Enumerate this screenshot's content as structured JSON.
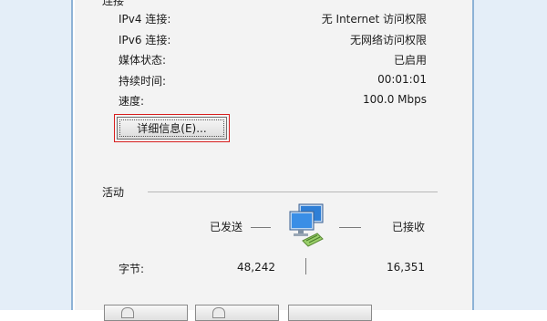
{
  "connection": {
    "title": "连接",
    "rows": [
      {
        "label": "IPv4 连接:",
        "value": "无 Internet 访问权限"
      },
      {
        "label": "IPv6 连接:",
        "value": "无网络访问权限"
      },
      {
        "label": "媒体状态:",
        "value": "已启用"
      },
      {
        "label": "持续时间:",
        "value": "00:01:01"
      },
      {
        "label": "速度:",
        "value": "100.0 Mbps"
      }
    ],
    "details_button": "详细信息(E)..."
  },
  "activity": {
    "title": "活动",
    "sent_label": "已发送",
    "received_label": "已接收",
    "bytes_label": "字节:",
    "bytes_sent": "48,242",
    "bytes_received": "16,351"
  },
  "colors": {
    "focus_border": "#d81e1e",
    "frame": "#e4eef8",
    "panel": "#f3f3f3"
  }
}
